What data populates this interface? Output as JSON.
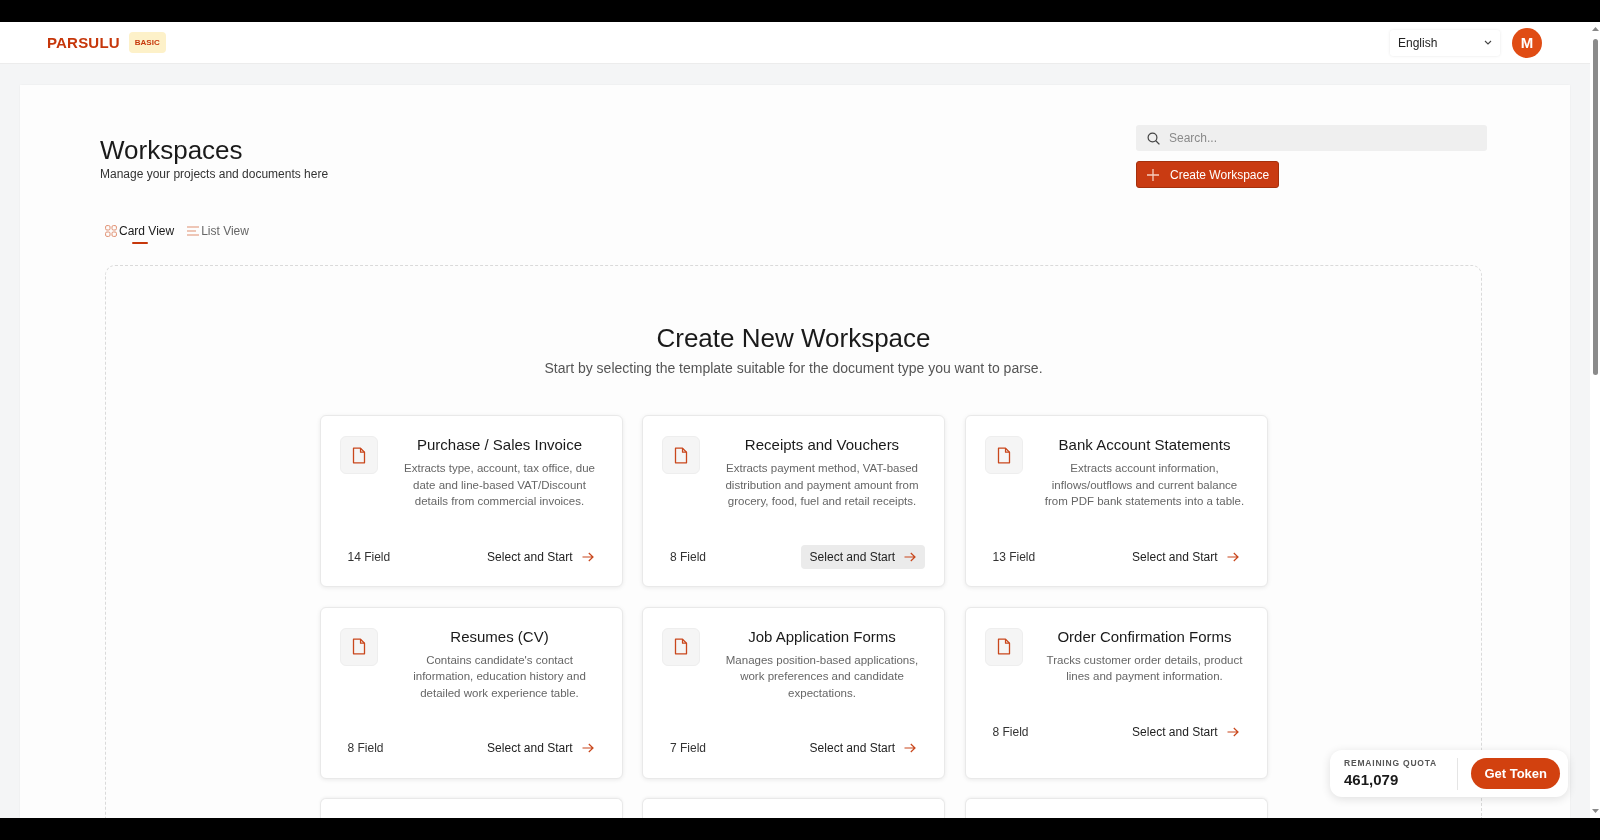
{
  "header": {
    "logo": "PARSULU",
    "plan_badge": "BASIC",
    "language": {
      "value": "English"
    },
    "avatar": {
      "initial": "M"
    }
  },
  "page": {
    "title": "Workspaces",
    "subtitle": "Manage your projects and documents here",
    "search": {
      "placeholder": "Search..."
    },
    "create_button": "Create Workspace"
  },
  "view_tabs": [
    {
      "label": "Card View",
      "kind": "grid",
      "selected": true
    },
    {
      "label": "List View",
      "kind": "list",
      "selected": false
    }
  ],
  "templates": {
    "title": "Create New Workspace",
    "subtitle": "Start by selecting the template suitable for the document type you want to parse.",
    "cards": [
      {
        "kind": "template",
        "title": "Purchase / Sales Invoice",
        "description": "Extracts type, account, tax office, due date and line-based VAT/Discount details from commercial invoices.",
        "field_count": "14 Field",
        "action": "Select and Start",
        "hovered": false
      },
      {
        "kind": "template",
        "title": "Receipts and Vouchers",
        "description": "Extracts payment method, VAT-based distribution and payment amount from grocery, food, fuel and retail receipts.",
        "field_count": "8 Field",
        "action": "Select and Start",
        "hovered": true
      },
      {
        "kind": "template",
        "title": "Bank Account Statements",
        "description": "Extracts account information, inflows/outflows and current balance from PDF bank statements into a table.",
        "field_count": "13 Field",
        "action": "Select and Start",
        "hovered": false
      },
      {
        "kind": "template",
        "title": "Resumes (CV)",
        "description": "Contains candidate's contact information, education history and detailed work experience table.",
        "field_count": "8 Field",
        "action": "Select and Start",
        "hovered": false
      },
      {
        "kind": "template",
        "title": "Job Application Forms",
        "description": "Manages position-based applications, work preferences and candidate expectations.",
        "field_count": "7 Field",
        "action": "Select and Start",
        "hovered": false
      },
      {
        "kind": "template",
        "title": "Order Confirmation Forms",
        "description": "Tracks customer order details, product lines and payment information.",
        "field_count": "8 Field",
        "action": "Select and Start",
        "hovered": false
      },
      {
        "kind": "cut-off"
      },
      {
        "kind": "cut-off"
      },
      {
        "kind": "cut-off"
      }
    ]
  },
  "quota": {
    "label": "REMAINING QUOTA",
    "value": "461,079",
    "button": "Get Token"
  }
}
